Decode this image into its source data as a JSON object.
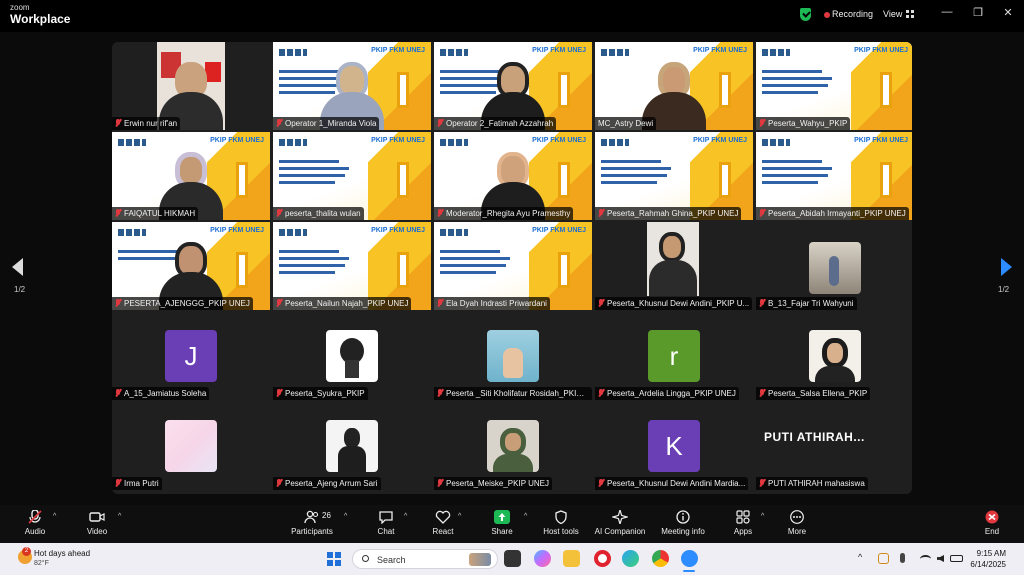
{
  "app": {
    "brand_line1": "zoom",
    "brand_line2": "Workplace",
    "recording": "Recording",
    "view": "View",
    "window_controls": [
      "—",
      "❐",
      "✕"
    ]
  },
  "slide": {
    "header": "PKIP FKM UNEJ"
  },
  "tiles": [
    {
      "name": "Erwin nur rif'an"
    },
    {
      "name": "Operator 1_Miranda Viola"
    },
    {
      "name": "Operator 2_Fatimah Azzahrah"
    },
    {
      "name": "MC_Astry Dewi"
    },
    {
      "name": "Peserta_Wahyu_PKIP"
    },
    {
      "name": "FAIQATUL HIKMAH"
    },
    {
      "name": "peserta_thalita wulan"
    },
    {
      "name": "Moderator_Rhegita Ayu Pramesthy"
    },
    {
      "name": "Peserta_Rahmah Ghina_PKIP UNEJ"
    },
    {
      "name": "Peserta_Abidah Irmayanti_PKIP UNEJ"
    },
    {
      "name": "PESERTA_AJENGGG_PKIP UNEJ"
    },
    {
      "name": "Peserta_Nailun Najah_PKIP UNEJ"
    },
    {
      "name": "Ela Dyah Indrasti Priwardani"
    },
    {
      "name": "Peserta_Khusnul Dewi Andini_PKIP U..."
    },
    {
      "name": "B_13_Fajar Tri Wahyuni"
    },
    {
      "name": "A_15_Jamiatus Soleha",
      "initial": "J",
      "color": "#6a3fb5"
    },
    {
      "name": "Peserta_Syukra_PKIP"
    },
    {
      "name": "Peserta _Siti Kholifatur Rosidah_PKIP ..."
    },
    {
      "name": "Peserta_Ardelia Lingga_PKIP UNEJ",
      "initial": "r",
      "color": "#5a9a2a"
    },
    {
      "name": "Peserta_Salsa Ellena_PKIP"
    },
    {
      "name": "Irma Putri"
    },
    {
      "name": "Peserta_Ajeng Arrum Sari"
    },
    {
      "name": "Peserta_Meiske_PKIP UNEJ"
    },
    {
      "name": "Peserta_Khusnul Dewi Andini Mardia..."
    },
    {
      "name": "PUTI ATHIRAH mahasiswa",
      "display": "PUTI  ATHIRAH..."
    }
  ],
  "pagination": {
    "left": "1/2",
    "right": "1/2"
  },
  "toolbar": {
    "audio": "Audio",
    "video": "Video",
    "participants": "Participants",
    "participants_count": "26",
    "chat": "Chat",
    "react": "React",
    "share": "Share",
    "host_tools": "Host tools",
    "ai_companion": "AI Companion",
    "meeting_info": "Meeting info",
    "apps": "Apps",
    "more": "More",
    "end": "End"
  },
  "taskbar": {
    "weather_title": "Hot days ahead",
    "weather_temp": "82°F",
    "weather_badge": "2",
    "search": "Search",
    "time": "9:15 AM",
    "date": "6/14/2025"
  },
  "colors": {
    "accent": "#2d8cff",
    "active_speaker": "#37c24a",
    "recording": "#e0383e",
    "end": "#e0383e",
    "slide_yellow": "#f7c325"
  }
}
